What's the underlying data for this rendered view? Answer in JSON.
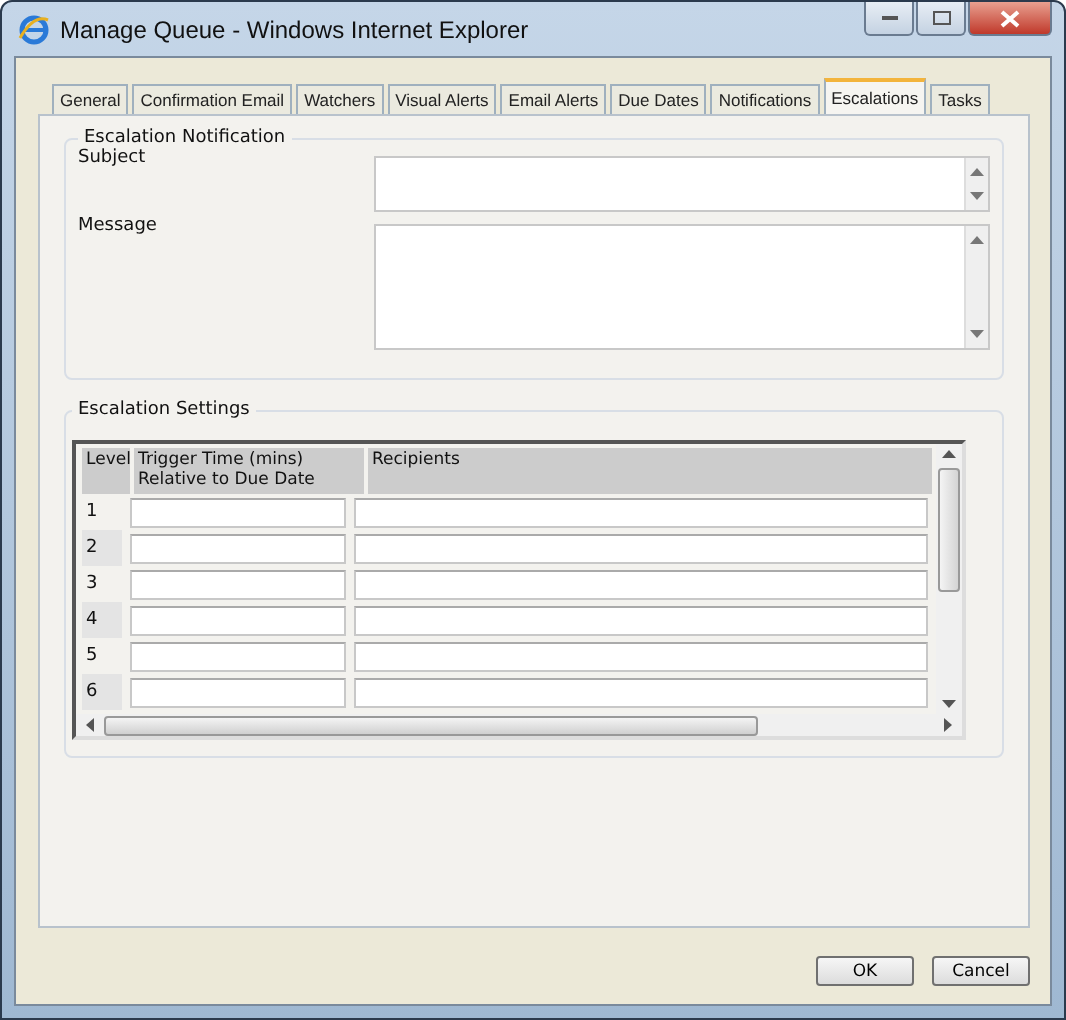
{
  "window": {
    "title": "Manage Queue - Windows Internet Explorer"
  },
  "tabs": [
    {
      "label": "General",
      "selected": false
    },
    {
      "label": "Confirmation Email",
      "selected": false
    },
    {
      "label": "Watchers",
      "selected": false
    },
    {
      "label": "Visual Alerts",
      "selected": false
    },
    {
      "label": "Email Alerts",
      "selected": false
    },
    {
      "label": "Due Dates",
      "selected": false
    },
    {
      "label": "Notifications",
      "selected": false
    },
    {
      "label": "Escalations",
      "selected": true
    },
    {
      "label": "Tasks",
      "selected": false
    }
  ],
  "notification": {
    "title": "Escalation Notification",
    "subject_label": "Subject",
    "message_label": "Message"
  },
  "settings": {
    "title": "Escalation Settings",
    "columns": [
      "Level",
      "Trigger Time (mins)\nRelative to Due Date",
      "Recipients"
    ],
    "rows": [
      {
        "level": "1"
      },
      {
        "level": "2"
      },
      {
        "level": "3"
      },
      {
        "level": "4"
      },
      {
        "level": "5"
      },
      {
        "level": "6"
      }
    ]
  },
  "buttons": [
    "OK",
    "Cancel"
  ]
}
